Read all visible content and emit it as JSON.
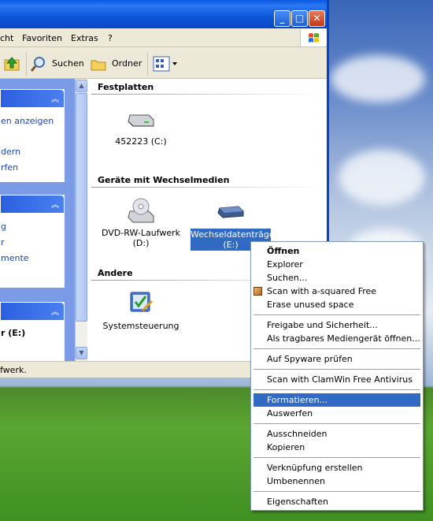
{
  "window": {
    "menubar": [
      "cht",
      "Favoriten",
      "Extras",
      "?"
    ],
    "toolbar": {
      "search": "Suchen",
      "folders": "Ordner"
    },
    "left_panel": {
      "p1_links": [
        "en anzeigen",
        "dern",
        "rfen"
      ],
      "p2_links": [
        "g",
        "r",
        "mente"
      ],
      "p3_label": "r (E:)"
    },
    "groups": {
      "hard_disks": "Festplatten",
      "removable": "Geräte mit Wechselmedien",
      "other": "Andere"
    },
    "items": {
      "disk_c": "452223 (C:)",
      "dvd_line1": "DVD-RW-Laufwerk",
      "dvd_line2": "(D:)",
      "removable_line1": "Wechseldatenträger",
      "removable_line2": "(E:)",
      "control_panel": "Systemsteuerung"
    },
    "status": "fwerk."
  },
  "context_menu": {
    "items": [
      {
        "label": "Öffnen",
        "bold": true
      },
      {
        "label": "Explorer"
      },
      {
        "label": "Suchen..."
      },
      {
        "label": "Scan with a-squared Free",
        "icon": "a-squared-icon"
      },
      {
        "label": "Erase unused space"
      },
      {
        "sep": true
      },
      {
        "label": "Freigabe und Sicherheit..."
      },
      {
        "label": "Als tragbares Mediengerät öffnen..."
      },
      {
        "sep": true
      },
      {
        "label": "Auf Spyware prüfen"
      },
      {
        "sep": true
      },
      {
        "label": "Scan with ClamWin Free Antivirus"
      },
      {
        "sep": true
      },
      {
        "label": "Formatieren...",
        "highlighted": true
      },
      {
        "label": "Auswerfen"
      },
      {
        "sep": true
      },
      {
        "label": "Ausschneiden"
      },
      {
        "label": "Kopieren"
      },
      {
        "sep": true
      },
      {
        "label": "Verknüpfung erstellen"
      },
      {
        "label": "Umbenennen"
      },
      {
        "sep": true
      },
      {
        "label": "Eigenschaften"
      }
    ]
  },
  "colors": {
    "selection": "#316ac5",
    "titlebar": "#0a5ae0",
    "taskpanel": "#7b9be6"
  }
}
